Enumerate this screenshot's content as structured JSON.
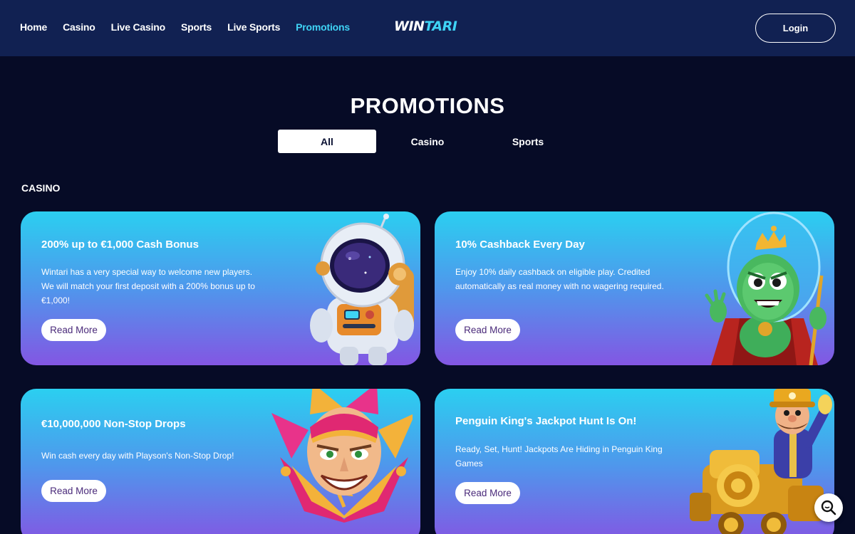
{
  "nav": {
    "items": [
      {
        "label": "Home"
      },
      {
        "label": "Casino"
      },
      {
        "label": "Live Casino"
      },
      {
        "label": "Sports"
      },
      {
        "label": "Live Sports"
      },
      {
        "label": "Promotions"
      }
    ],
    "active": "Promotions"
  },
  "brand": {
    "logo_part1": "WIN",
    "logo_part2": "TARI"
  },
  "header": {
    "login_label": "Login"
  },
  "page": {
    "title": "PROMOTIONS"
  },
  "tabs": [
    {
      "label": "All"
    },
    {
      "label": "Casino"
    },
    {
      "label": "Sports"
    }
  ],
  "section": {
    "label": "CASINO"
  },
  "cards": [
    {
      "title": "200% up to €1,000 Cash Bonus",
      "description": "Wintari has a very special way to welcome new players. We will match your first deposit with a 200% bonus up to €1,000!",
      "button": "Read More",
      "art_icon": "astronaut-illustration"
    },
    {
      "title": "10% Cashback Every Day",
      "description": "Enjoy 10% daily cashback on eligible play. Credited automatically as real money with no wagering required.",
      "button": "Read More",
      "art_icon": "alien-king-illustration"
    },
    {
      "title": "€10,000,000 Non-Stop Drops",
      "description": "Win cash every day with Playson's Non-Stop Drop!",
      "button": "Read More",
      "art_icon": "jester-illustration"
    },
    {
      "title": "Penguin King's Jackpot Hunt Is On!",
      "description": "Ready, Set, Hunt! Jackpots Are Hiding in Penguin King Games",
      "button": "Read More",
      "art_icon": "conductor-train-illustration"
    }
  ],
  "colors": {
    "background": "#060b26",
    "header": "#112152",
    "accent": "#3fd3f5",
    "card_top": "#2bcff0",
    "card_bottom": "#8356e3"
  },
  "widgets": {
    "zoom_icon": "search-icon"
  }
}
